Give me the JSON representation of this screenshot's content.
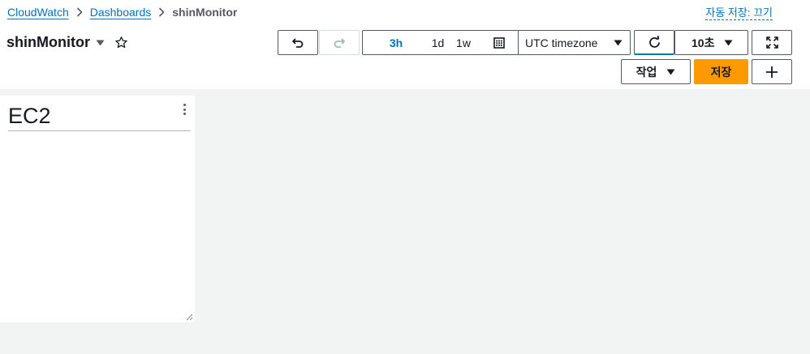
{
  "breadcrumb": {
    "items": [
      "CloudWatch",
      "Dashboards"
    ],
    "current": "shinMonitor"
  },
  "autosave_label": "자동 저장: 끄기",
  "dashboard": {
    "title": "shinMonitor"
  },
  "toolbar": {
    "ranges": [
      "3h",
      "1d",
      "1w"
    ],
    "active_range": "3h",
    "timezone": "UTC timezone",
    "refresh_interval": "10초",
    "actions_label": "작업",
    "save_label": "저장"
  },
  "widget": {
    "title": "EC2"
  },
  "colors": {
    "link": "#0073bb",
    "primary": "#ff9900",
    "border": "#545b64",
    "background": "#f2f3f3"
  },
  "icons": [
    "chevron-right-icon",
    "caret-down-icon",
    "star-icon",
    "undo-icon",
    "redo-icon",
    "calendar-icon",
    "refresh-icon",
    "fullscreen-icon",
    "plus-icon",
    "more-vertical-icon",
    "resize-handle-icon"
  ]
}
